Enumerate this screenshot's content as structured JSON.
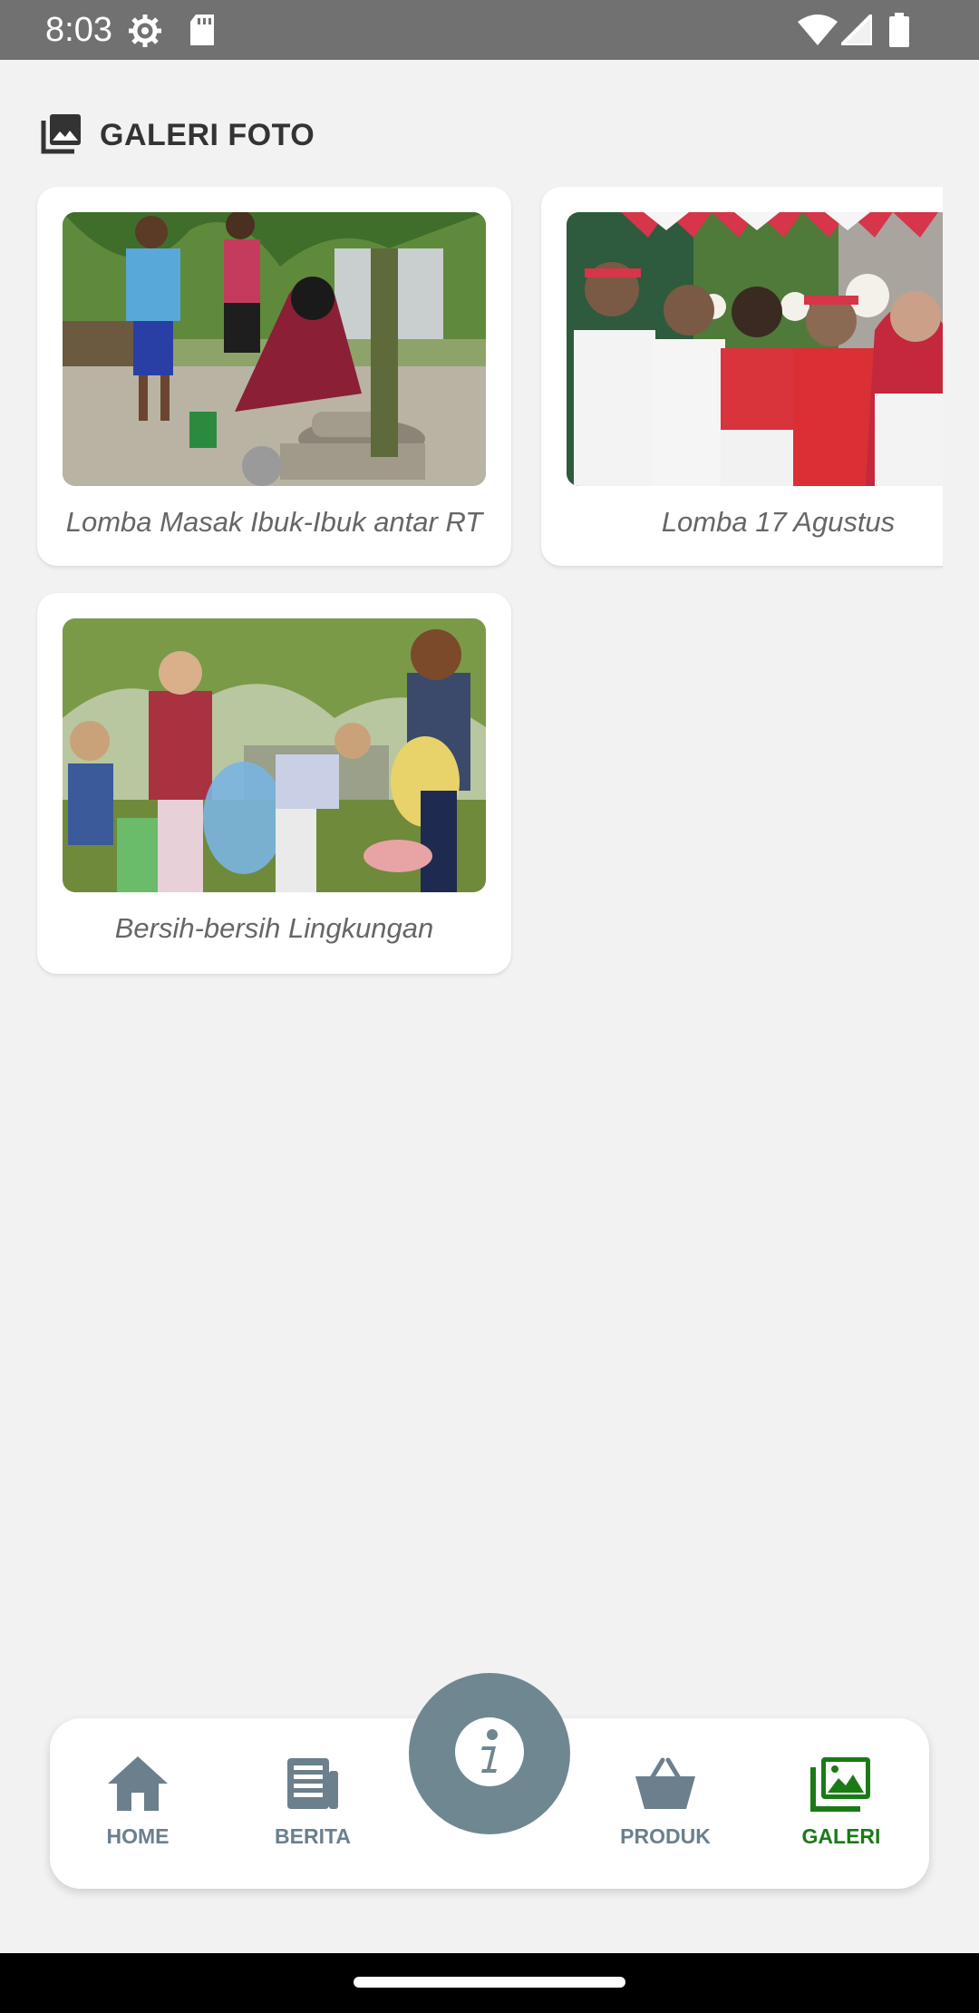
{
  "status_bar": {
    "time": "8:03",
    "icons": [
      "settings-gear-icon",
      "sd-card-icon",
      "wifi-icon",
      "signal-icon",
      "battery-icon"
    ]
  },
  "section": {
    "icon": "photo-library-icon",
    "title": "GALERI FOTO"
  },
  "gallery": {
    "items": [
      {
        "caption": "Lomba Masak Ibuk-Ibuk antar RT",
        "photo": "women-cooking-outdoors-photo"
      },
      {
        "caption": "Lomba 17 Agustus",
        "photo": "group-red-white-celebration-photo"
      },
      {
        "caption": "Bersih-bersih Lingkungan",
        "photo": "children-cleaning-park-photo"
      }
    ]
  },
  "bottom_nav": {
    "items": [
      {
        "label": "HOME",
        "icon": "home-icon",
        "active": false
      },
      {
        "label": "BERITA",
        "icon": "newspaper-icon",
        "active": false
      },
      {
        "label": "PRODUK",
        "icon": "basket-icon",
        "active": false
      },
      {
        "label": "GALERI",
        "icon": "gallery-icon",
        "active": true
      }
    ],
    "fab_icon": "info-icon"
  },
  "colors": {
    "background": "#f2f2f2",
    "status_bar": "#717171",
    "nav_inactive": "#6b7f8c",
    "nav_active": "#1b7a16",
    "fab": "#6f8791"
  }
}
